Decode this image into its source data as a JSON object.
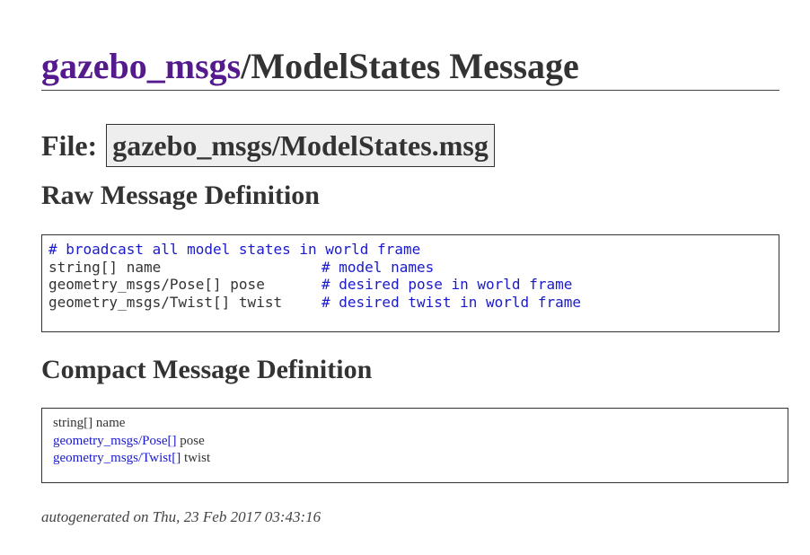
{
  "title": {
    "package": "gazebo_msgs",
    "rest": "/ModelStates Message"
  },
  "file": {
    "label": "File:",
    "path": "gazebo_msgs/ModelStates.msg"
  },
  "raw": {
    "heading": "Raw Message Definition",
    "lines": [
      {
        "decl": "",
        "comment": "# broadcast all model states in world frame"
      },
      {
        "decl": "string[] name",
        "comment": "# model names"
      },
      {
        "decl": "geometry_msgs/Pose[] pose",
        "comment": "# desired pose in world frame"
      },
      {
        "decl": "geometry_msgs/Twist[] twist",
        "comment": "# desired twist in world frame"
      }
    ]
  },
  "compact": {
    "heading": "Compact Message Definition",
    "lines": [
      {
        "type": "string[]",
        "name": "name",
        "linked": false
      },
      {
        "type": "geometry_msgs/Pose[]",
        "name": "pose",
        "linked": true
      },
      {
        "type": "geometry_msgs/Twist[]",
        "name": "twist",
        "linked": true
      }
    ]
  },
  "footer": "autogenerated on Thu, 23 Feb 2017 03:43:16",
  "colors": {
    "link_visited": "#551a8b",
    "link": "#1a1acc",
    "text": "#333333",
    "file_box_bg": "#eeeeee"
  }
}
